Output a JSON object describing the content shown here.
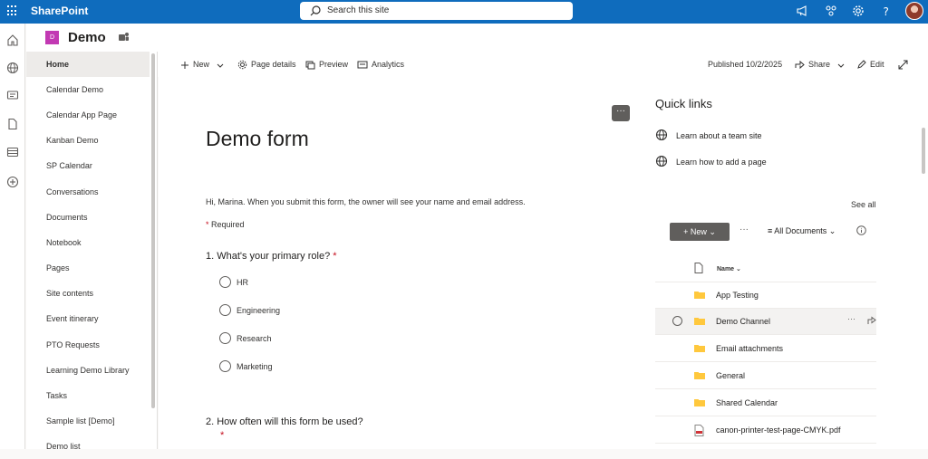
{
  "topbar": {
    "brand": "SharePoint",
    "search_placeholder": "Search this site"
  },
  "site": {
    "logo_letter": "D",
    "name": "Demo"
  },
  "nav": {
    "items": [
      {
        "label": "Home",
        "active": true
      },
      {
        "label": "Calendar Demo"
      },
      {
        "label": "Calendar App Page"
      },
      {
        "label": "Kanban Demo"
      },
      {
        "label": "SP Calendar"
      },
      {
        "label": "Conversations"
      },
      {
        "label": "Documents"
      },
      {
        "label": "Notebook"
      },
      {
        "label": "Pages"
      },
      {
        "label": "Site contents"
      },
      {
        "label": "Event itinerary"
      },
      {
        "label": "PTO Requests"
      },
      {
        "label": "Learning Demo Library"
      },
      {
        "label": "Tasks"
      },
      {
        "label": "Sample list [Demo]"
      },
      {
        "label": "Demo list"
      }
    ]
  },
  "commandbar": {
    "new": "New",
    "page_details": "Page details",
    "preview": "Preview",
    "analytics": "Analytics",
    "published": "Published 10/2/2025",
    "share": "Share",
    "edit": "Edit"
  },
  "form": {
    "more": "···",
    "title": "Demo form",
    "intro": "Hi, Marina. When you submit this form, the owner will see your name and email address.",
    "required_star": "*",
    "required_label": "Required",
    "q1": "1. What's your primary role?",
    "q1_star": "*",
    "options": [
      "HR",
      "Engineering",
      "Research",
      "Marketing"
    ],
    "q2": "2. How often will this form be used?",
    "q2_star": "*"
  },
  "quicklinks": {
    "title": "Quick links",
    "items": [
      "Learn about a team site",
      "Learn how to add a page"
    ]
  },
  "library": {
    "see_all": "See all",
    "new": "New",
    "more": "···",
    "view": "All Documents",
    "column_name": "Name",
    "rows": [
      {
        "name": "App Testing",
        "type": "folder"
      },
      {
        "name": "Demo Channel",
        "type": "folder",
        "selected": true
      },
      {
        "name": "Email attachments",
        "type": "folder"
      },
      {
        "name": "General",
        "type": "folder"
      },
      {
        "name": "Shared Calendar",
        "type": "folder"
      },
      {
        "name": "canon-printer-test-page-CMYK.pdf",
        "type": "pdf"
      }
    ]
  },
  "colors": {
    "suite_bar": "#0f6cbd",
    "site_logo": "#c239b3",
    "folder": "#ffc83d",
    "required": "#c50f1f"
  }
}
